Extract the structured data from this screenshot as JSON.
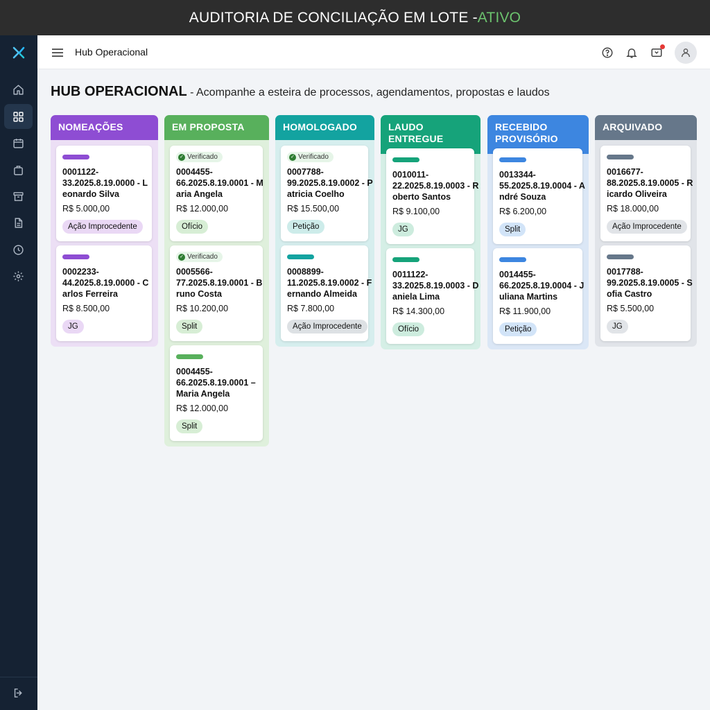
{
  "app": {
    "banner_title": "AUDITORIA DE CONCILIAÇÃO EM LOTE - ",
    "banner_status": "ATIVO",
    "header_title": "Hub Operacional"
  },
  "sidebar": {
    "items": [
      {
        "name": "home",
        "icon": "home-icon"
      },
      {
        "name": "dashboard",
        "icon": "grid-icon",
        "active": true
      },
      {
        "name": "calendar",
        "icon": "calendar-icon"
      },
      {
        "name": "briefcase",
        "icon": "briefcase-icon"
      },
      {
        "name": "archive",
        "icon": "archive-icon"
      },
      {
        "name": "document",
        "icon": "document-icon"
      },
      {
        "name": "history",
        "icon": "clock-icon"
      },
      {
        "name": "settings",
        "icon": "gear-icon"
      }
    ],
    "logout_icon": "logout-icon"
  },
  "page": {
    "title": "HUB OPERACIONAL",
    "subtitle": " - Acompanhe a esteira de processos, agendamentos, propostas e laudos"
  },
  "colors": {
    "accent_green": "#6cc36e",
    "sidebar_bg": "#152233"
  },
  "columns": [
    {
      "title": "NOMEAÇÕES",
      "color": "#8e4dd3",
      "bar": "#8e4dd3",
      "bg": "#ecdff5",
      "cards": [
        {
          "number": "0001122-\n33.2025.8.19.0000 - Leonardo Silva",
          "value": "R$ 5.000,00",
          "tag": "Ação Improcedente",
          "tag_bg": "#ead8f5"
        },
        {
          "number": "0002233-\n44.2025.8.19.0000 - Carlos Ferreira",
          "value": "R$ 8.500,00",
          "tag": "JG",
          "tag_bg": "#ead8f5"
        }
      ]
    },
    {
      "title": "EM PROPOSTA",
      "color": "#58b05c",
      "bar": "#58b05c",
      "bg": "#dff0dc",
      "cards": [
        {
          "verified": "Verificado",
          "number": "0004455-\n66.2025.8.19.0001 - Maria Angela",
          "value": "R$ 12.000,00",
          "tag": "Ofício",
          "tag_bg": "#d7eed5"
        },
        {
          "verified": "Verificado",
          "number": "0005566-\n77.2025.8.19.0001 - Bruno Costa",
          "value": "R$ 10.200,00",
          "tag": "Split",
          "tag_bg": "#d7eed5"
        },
        {
          "number": "0004455-\n66.2025.8.19.0001 – Maria Angela",
          "value": "R$ 12.000,00",
          "tag": "Split",
          "tag_bg": "#d7eed5"
        }
      ]
    },
    {
      "title": "HOMOLOGADO",
      "color": "#13a3a0",
      "bar": "#13a3a0",
      "bg": "#d6eeee",
      "cards": [
        {
          "verified": "Verificado",
          "number": "0007788-\n99.2025.8.19.0002 - Patricia Coelho",
          "value": "R$ 15.500,00",
          "tag": "Petição",
          "tag_bg": "#cdecea"
        },
        {
          "number": "0008899-\n11.2025.8.19.0002 - Fernando Almeida",
          "value": "R$ 7.800,00",
          "tag": "Ação Improcedente",
          "tag_bg": "#dde1e4"
        }
      ]
    },
    {
      "title": "LAUDO ENTREGUE",
      "color": "#16a37a",
      "bar": "#16a37a",
      "bg": "#d5efe6",
      "cards": [
        {
          "number": "0010011-\n22.2025.8.19.0003 - Roberto Santos",
          "value": "R$ 9.100,00",
          "tag": "JG",
          "tag_bg": "#cdecde"
        },
        {
          "number": "0011122-\n33.2025.8.19.0003 - Daniela Lima",
          "value": "R$ 14.300,00",
          "tag": "Ofício",
          "tag_bg": "#cdecde"
        }
      ]
    },
    {
      "title": "RECEBIDO PROVISÓRIO",
      "color": "#3d86e0",
      "bar": "#3d86e0",
      "bg": "#dbe7f6",
      "cards": [
        {
          "number": "0013344-\n55.2025.8.19.0004 - André Souza",
          "value": "R$ 6.200,00",
          "tag": "Split",
          "tag_bg": "#d2e4f8"
        },
        {
          "number": "0014455-\n66.2025.8.19.0004 - Juliana Martins",
          "value": "R$ 11.900,00",
          "tag": "Petição",
          "tag_bg": "#d2e4f8"
        }
      ]
    },
    {
      "title": "ARQUIVADO",
      "color": "#66778a",
      "bar": "#66778a",
      "bg": "#e1e4e9",
      "cards": [
        {
          "number": "0016677-\n88.2025.8.19.0005 - Ricardo Oliveira",
          "value": "R$ 18.000,00",
          "tag": "Ação Improcedente",
          "tag_bg": "#e1e4e8"
        },
        {
          "number": "0017788-\n99.2025.8.19.0005 - Sofia Castro",
          "value": "R$ 5.500,00",
          "tag": "JG",
          "tag_bg": "#e1e4e8"
        }
      ]
    }
  ]
}
